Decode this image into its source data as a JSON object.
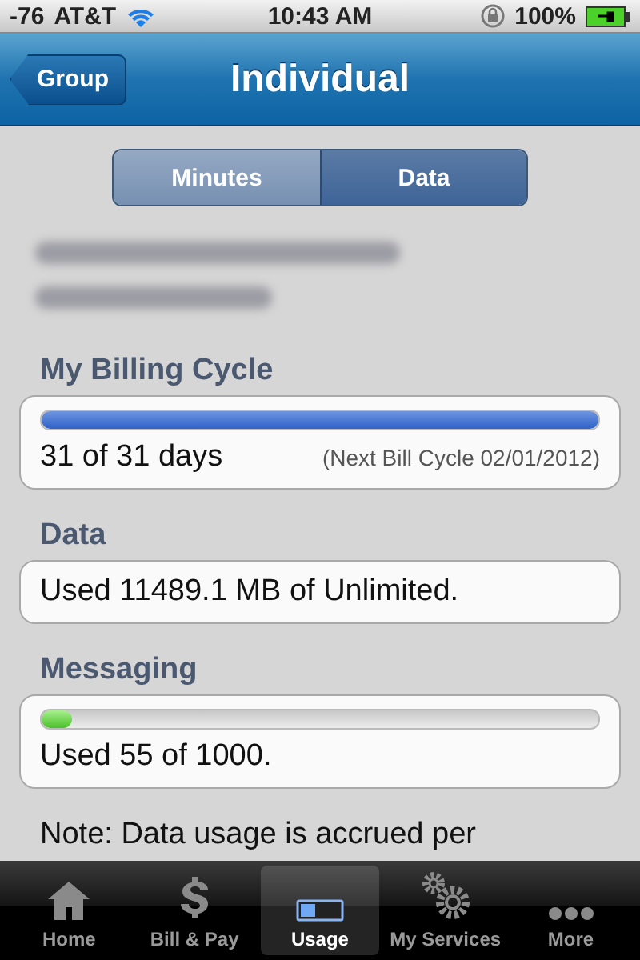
{
  "status_bar": {
    "signal": "-76",
    "carrier": "AT&T",
    "time": "10:43 AM",
    "battery": "100%"
  },
  "nav_bar": {
    "back": "Group",
    "title": "Individual"
  },
  "segments": [
    {
      "label": "Minutes",
      "selected": false
    },
    {
      "label": "Data",
      "selected": true
    }
  ],
  "sections": [
    {
      "heading": "My Billing Cycle",
      "level": 1,
      "text": "31 of 31 days",
      "note": "(Next Bill Cycle 02/01/2012)"
    },
    {
      "heading": "Data",
      "text": "Used 11489.1 MB of Unlimited."
    },
    {
      "heading": "Messaging",
      "level": 0.055,
      "text": "Used 55 of 1000."
    }
  ],
  "note": "Note: Data usage is accrued per",
  "tab_bar": [
    {
      "label": "Home",
      "selected": false
    },
    {
      "label": "Bill & Pay",
      "selected": false
    },
    {
      "label": "Usage",
      "selected": true
    },
    {
      "label": "My Services",
      "selected": false
    },
    {
      "label": "More",
      "selected": false
    }
  ]
}
